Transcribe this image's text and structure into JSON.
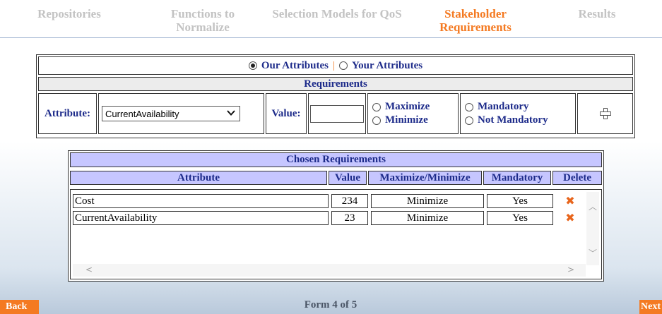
{
  "wizard": {
    "steps": [
      {
        "label": "Repositories"
      },
      {
        "label": "Functions to Normalize"
      },
      {
        "label": "Selection Models for QoS"
      },
      {
        "label": "Stakeholder Requirements"
      },
      {
        "label": "Results"
      }
    ],
    "active_step": 4
  },
  "attributes_panel": {
    "option_ours": "Our Attributes",
    "option_yours": "Your Attributes",
    "separator": "|",
    "selected_option": "Our Attributes",
    "section_title": "Requirements",
    "attribute_label": "Attribute:",
    "attribute_value": "CurrentAvailability",
    "value_label": "Value:",
    "value_input": "",
    "maximize_label": "Maximize",
    "minimize_label": "Minimize",
    "mandatory_label": "Mandatory",
    "not_mandatory_label": "Not Mandatory",
    "add_icon": "plus-icon"
  },
  "chosen": {
    "title": "Chosen Requirements",
    "columns": [
      "Attribute",
      "Value",
      "Maximize/Minimize",
      "Mandatory",
      "Delete"
    ],
    "rows": [
      {
        "attribute": "Cost",
        "value": "234",
        "objective": "Minimize",
        "mandatory": "Yes"
      },
      {
        "attribute": "CurrentAvailability",
        "value": "23",
        "objective": "Minimize",
        "mandatory": "Yes"
      }
    ]
  },
  "footer": {
    "back_label": "Back",
    "next_label": "Next",
    "form_counter": "Form 4 of 5"
  },
  "colors": {
    "accent": "#f47a22",
    "label_text": "#1d2b8a",
    "header_fill": "#c6c6ff"
  }
}
